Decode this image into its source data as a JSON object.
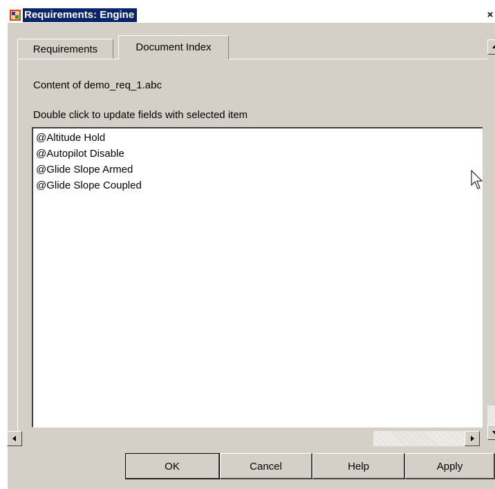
{
  "window": {
    "title": "Requirements: Engine",
    "close_glyph": "×"
  },
  "tabs": [
    {
      "label": "Requirements",
      "active": false
    },
    {
      "label": "Document Index",
      "active": true
    }
  ],
  "content_label": "Content of demo_req_1.abc",
  "hint_label": "Double click to update fields with selected item",
  "list": {
    "items": [
      "@Altitude Hold",
      "@Autopilot Disable",
      "@Glide Slope Armed",
      "@Glide Slope Coupled"
    ]
  },
  "buttons": {
    "ok": "OK",
    "cancel": "Cancel",
    "help": "Help",
    "apply": "Apply"
  },
  "colors": {
    "title_bg": "#0a246a",
    "dialog_bg": "#d4d0c8"
  },
  "icons": {
    "app": "simulink-block-icon",
    "close": "close-icon",
    "scroll_up": "arrow-up-icon",
    "scroll_down": "arrow-down-icon",
    "scroll_left": "arrow-left-icon",
    "scroll_right": "arrow-right-icon",
    "cursor": "mouse-pointer-icon"
  }
}
